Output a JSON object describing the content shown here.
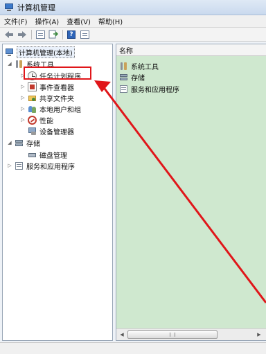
{
  "window": {
    "title": "计算机管理"
  },
  "menu": [
    "文件(F)",
    "操作(A)",
    "查看(V)",
    "帮助(H)"
  ],
  "toolbar": [
    "back-arrow-icon",
    "forward-arrow-icon",
    "console-tree-icon",
    "export-list-icon",
    "help-icon",
    "properties-icon"
  ],
  "tree": {
    "root": "计算机管理(本地)",
    "system_tools": "系统工具",
    "task_scheduler": "任务计划程序",
    "event_viewer": "事件查看器",
    "shared_folders": "共享文件夹",
    "local_users": "本地用户和组",
    "performance": "性能",
    "device_manager": "设备管理器",
    "storage": "存储",
    "disk_management": "磁盘管理",
    "services_apps": "服务和应用程序"
  },
  "list": {
    "header": "名称",
    "items": [
      "系统工具",
      "存储",
      "服务和应用程序"
    ]
  },
  "scrollbar": {
    "left": "◀",
    "right": "▶"
  },
  "colors": {
    "highlight": "#e0161a",
    "list_bg": "#cfe8cf"
  }
}
